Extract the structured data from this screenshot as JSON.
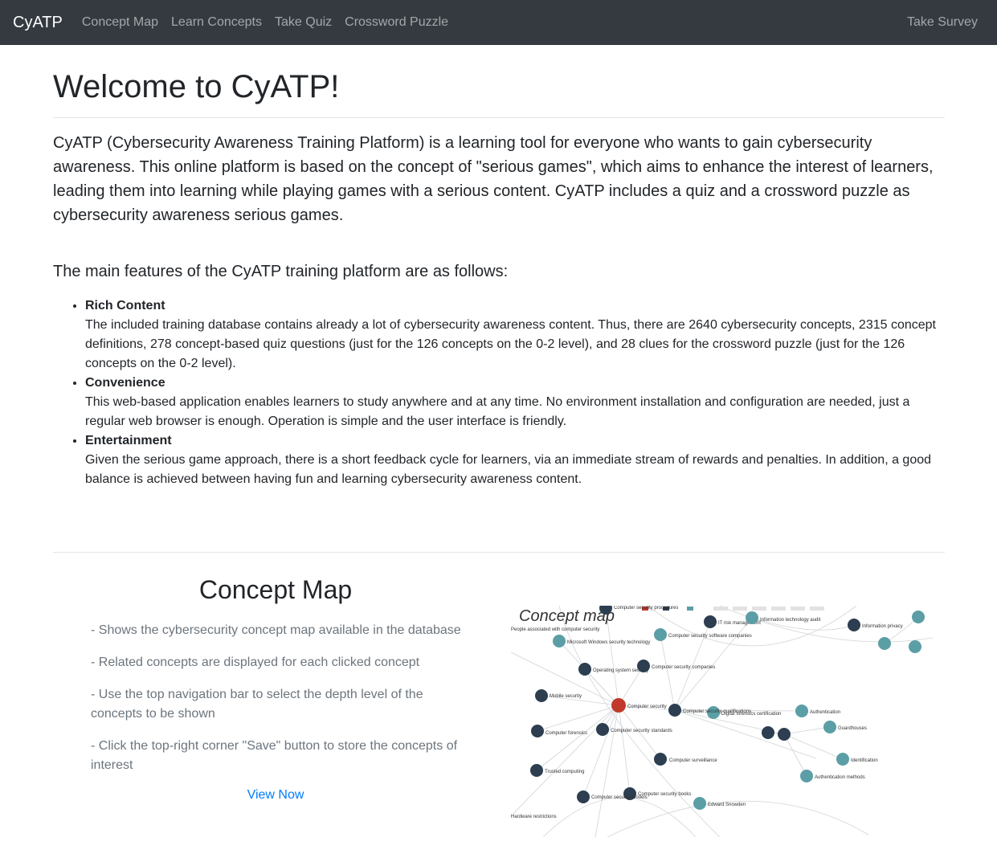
{
  "navbar": {
    "brand": "CyATP",
    "links": [
      "Concept Map",
      "Learn Concepts",
      "Take Quiz",
      "Crossword Puzzle"
    ],
    "right_link": "Take Survey"
  },
  "welcome": {
    "title": "Welcome to CyATP!",
    "intro_part1": "CyATP (Cybersecurity Awareness Training Platform) is a learning tool for everyone who wants to gain cybersecurity awareness. This online platform is based on the concept of \"serious games\", which aims to enhance the interest of learners, leading them into learning while playing games with a serious content. CyATP includes a ",
    "intro_quiz": "quiz",
    "intro_and": " and a ",
    "intro_crossword": "crossword puzzle",
    "intro_end": " as cybersecurity awareness serious games.",
    "features_lead": "The main features of the CyATP training platform are as follows:"
  },
  "features": [
    {
      "title": "Rich Content",
      "text": "The included training database contains already a lot of cybersecurity awareness content. Thus, there are 2640 cybersecurity concepts, 2315 concept definitions, 278 concept-based quiz questions (just for the 126 concepts on the 0-2 level), and 28 clues for the crossword puzzle (just for the 126 concepts on the 0-2 level)."
    },
    {
      "title": "Convenience",
      "text": "This web-based application enables learners to study anywhere and at any time. No environment installation and configuration are needed, just a regular web browser is enough. Operation is simple and the user interface is friendly."
    },
    {
      "title": "Entertainment",
      "text": "Given the serious game approach, there is a short feedback cycle for learners, via an immediate stream of rewards and penalties. In addition, a good balance is achieved between having fun and learning cybersecurity awareness content."
    }
  ],
  "concept_map": {
    "heading": "Concept Map",
    "bullets": [
      "- Shows the cybersecurity concept map available in the database",
      "- Related concepts are displayed for each clicked concept",
      "- Use the top navigation bar to select the depth level of the concepts to be shown",
      "- Click the top-right corner \"Save\" button to store the concepts of interest"
    ],
    "view_link": "View Now",
    "image": {
      "title": "Concept map",
      "nodes": [
        "Computer security procedures",
        "IT risk management",
        "Information technology audit",
        "Information privacy",
        "People associated with computer security",
        "Microsoft Windows security technology",
        "Computer security software companies",
        "Operating system security",
        "Computer security companies",
        "Mobile security",
        "Computer security",
        "Computer security qualifications",
        "Digital forensics certification",
        "Authentication",
        "Guardhouses",
        "Computer forensics",
        "Computer security standards",
        "Computer surveillance",
        "Identification",
        "Trusted computing",
        "Authentication methods",
        "Computer security models",
        "Computer security books",
        "Edward Snowden",
        "Hardware restrictions"
      ]
    }
  },
  "colors": {
    "navbar_bg": "#343a40",
    "link": "#007bff",
    "muted": "#6c757d",
    "node_dark": "#2c3e50",
    "node_teal": "#5b9ea6",
    "node_root": "#c0392b"
  }
}
